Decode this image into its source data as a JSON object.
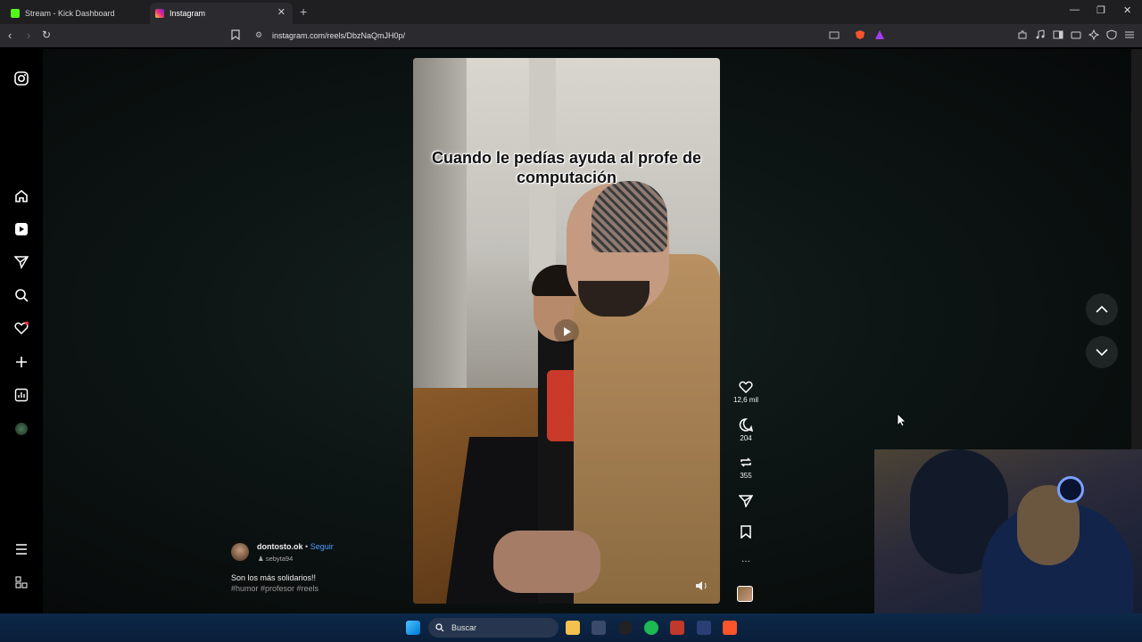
{
  "browser": {
    "tabs": [
      {
        "title": "Stream - Kick Dashboard",
        "favicon_color": "#53fc18"
      },
      {
        "title": "Instagram",
        "favicon_color": "#e1306c"
      }
    ],
    "url": "instagram.com/reels/DbzNaQmJH0p/"
  },
  "reel": {
    "caption": "Cuando le pedías ayuda al profe de computación",
    "username": "dontosto.ok",
    "separator": "•",
    "follow_label": "Seguir",
    "audio": "sebyta94",
    "description": "Son los más solidarios!!",
    "hashtags": "#humor #profesor #reels",
    "likes": "12,6 mil",
    "comments": "204",
    "reposts": "355",
    "more": "···"
  },
  "taskbar": {
    "search_placeholder": "Buscar"
  },
  "colors": {
    "accent_link": "#4c9dff",
    "taskbar": "#0a2040",
    "notification": "#ff3040"
  }
}
